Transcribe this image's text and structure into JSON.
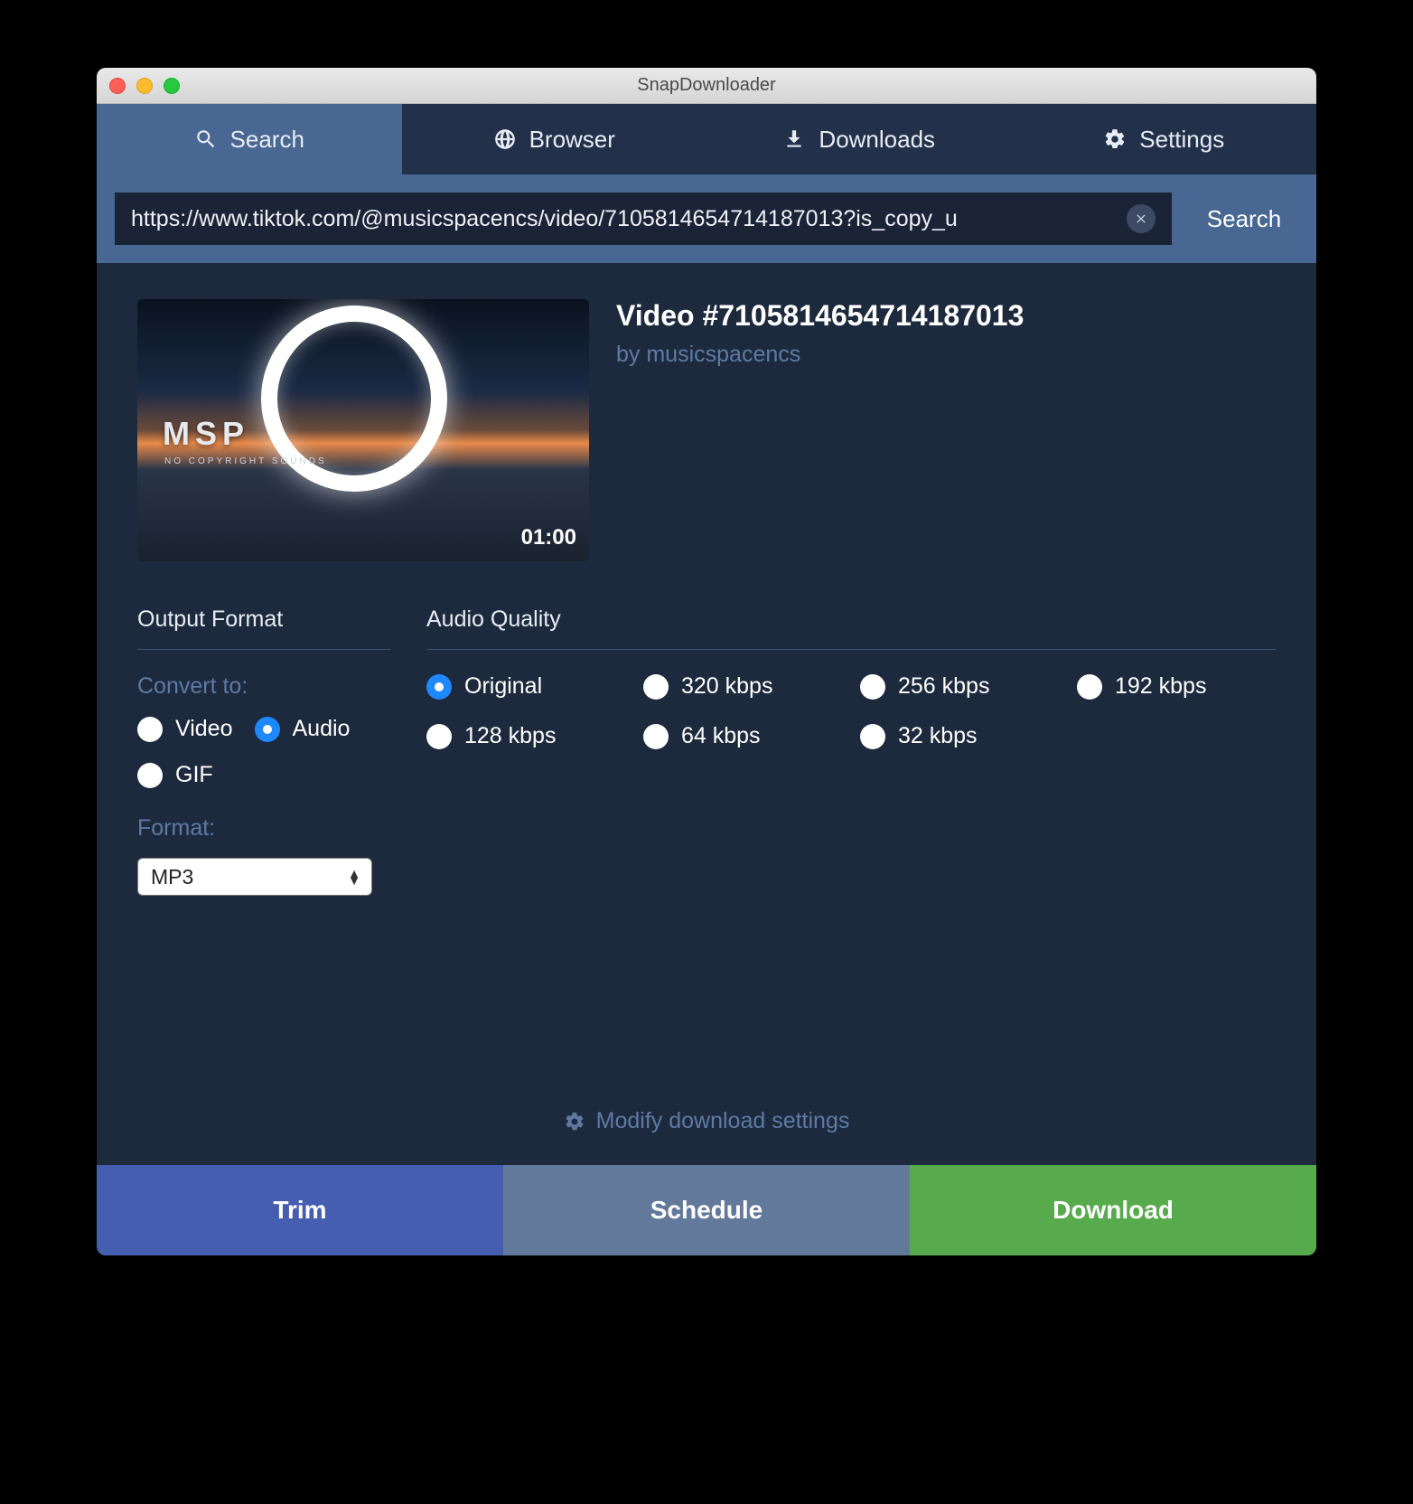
{
  "window": {
    "title": "SnapDownloader"
  },
  "tabs": {
    "search": "Search",
    "browser": "Browser",
    "downloads": "Downloads",
    "settings": "Settings",
    "active": "search"
  },
  "search": {
    "url": "https://www.tiktok.com/@musicspacencs/video/7105814654714187013?is_copy_u",
    "button_label": "Search"
  },
  "video": {
    "title": "Video #7105814654714187013",
    "author": "by musicspacencs",
    "duration": "01:00",
    "thumb_logo": "MSP",
    "thumb_sub": "NO COPYRIGHT SOUNDS"
  },
  "output": {
    "section_label": "Output Format",
    "convert_label": "Convert to:",
    "options": {
      "video": "Video",
      "audio": "Audio",
      "gif": "GIF"
    },
    "selected": "audio",
    "format_label": "Format:",
    "format_value": "MP3"
  },
  "quality": {
    "section_label": "Audio Quality",
    "options": [
      "Original",
      "320 kbps",
      "256 kbps",
      "192 kbps",
      "128 kbps",
      "64 kbps",
      "32 kbps"
    ],
    "selected": "Original"
  },
  "modify_label": "Modify download settings",
  "footer": {
    "trim": "Trim",
    "schedule": "Schedule",
    "download": "Download"
  }
}
